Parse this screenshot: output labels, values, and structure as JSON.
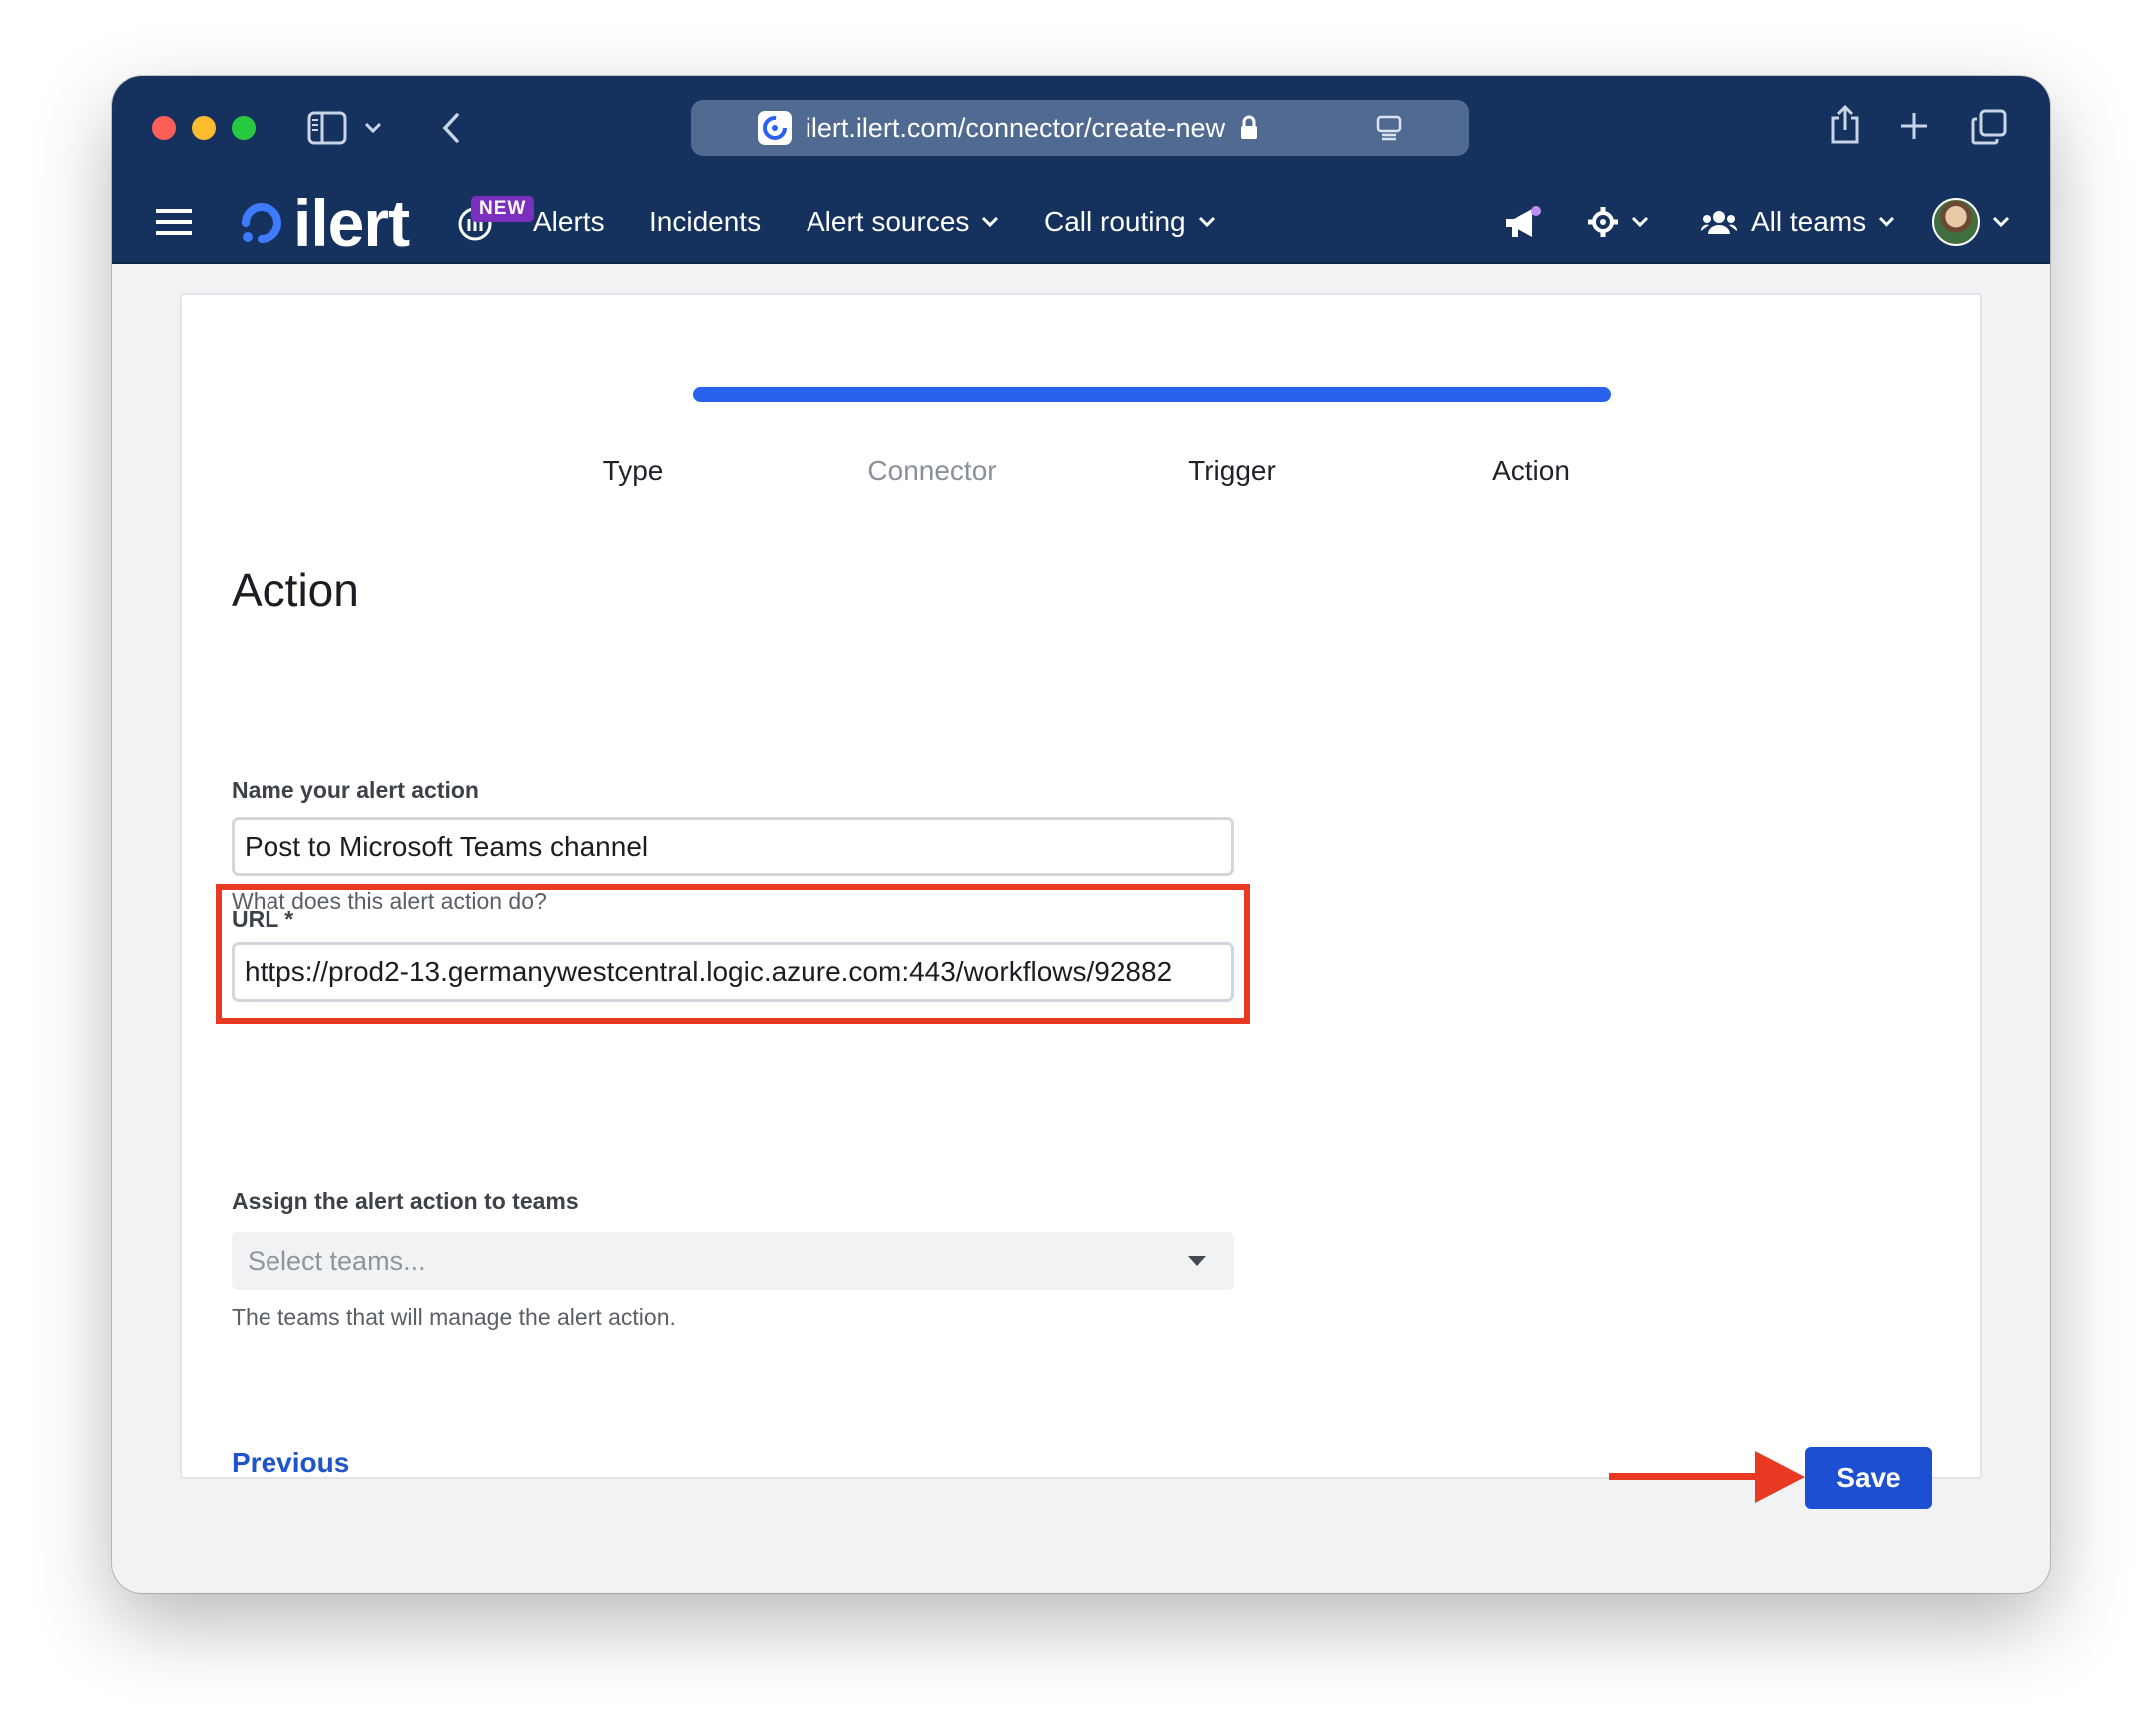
{
  "browser": {
    "url": "ilert.ilert.com/connector/create-new"
  },
  "nav": {
    "logo_text": "ilert",
    "new_badge": "NEW",
    "items": [
      {
        "label": "Alerts"
      },
      {
        "label": "Incidents"
      },
      {
        "label": "Alert sources"
      },
      {
        "label": "Call routing"
      }
    ],
    "teams_label": "All teams"
  },
  "wizard": {
    "progress_fraction": 1.0,
    "steps": [
      {
        "label": "Type",
        "state": "done"
      },
      {
        "label": "Connector",
        "state": "muted"
      },
      {
        "label": "Trigger",
        "state": "done"
      },
      {
        "label": "Action",
        "state": "current"
      }
    ]
  },
  "form": {
    "title": "Action",
    "name_label": "Name your alert action",
    "name_value": "Post to Microsoft Teams channel",
    "name_help": "What does this alert action do?",
    "url_label": "URL *",
    "url_value": "https://prod2-13.germanywestcentral.logic.azure.com:443/workflows/92882",
    "teams_label": "Assign the alert action to teams",
    "teams_placeholder": "Select teams...",
    "teams_help": "The teams that will manage the alert action."
  },
  "actions": {
    "previous": "Previous",
    "save": "Save"
  },
  "colors": {
    "navbar": "#14325d",
    "accent": "#2962ec",
    "annotation": "#e83a23",
    "save_button": "#1d4fd3"
  }
}
